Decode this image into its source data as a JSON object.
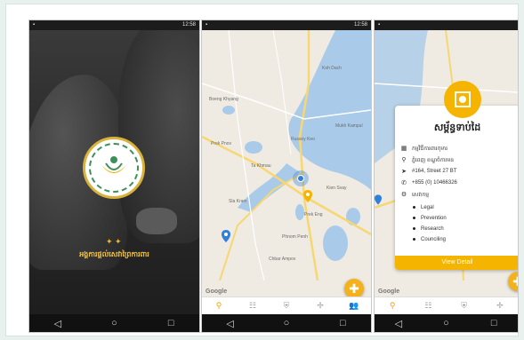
{
  "statusbar": {
    "time1": "12:58",
    "time2": "12:58",
    "time3": "",
    "icons": "▾ ▮"
  },
  "splash": {
    "brand_mark": "✦ ✦",
    "title": "អង្គការផ្តល់សេវាព្រៃការពារ"
  },
  "map": {
    "labels": [
      "Prek Pnov",
      "Ta Khmau",
      "Koh Dach",
      "Russey Keo",
      "Kien Svay",
      "Prek Eng",
      "Sla Kram",
      "Phnom Penh",
      "Boeng Khyang",
      "Mukh Kampul",
      "Chbar Ampov"
    ],
    "google": "Google"
  },
  "tabs": [
    {
      "icon": "location-pin-icon",
      "glyph": "⚲"
    },
    {
      "icon": "list-icon",
      "glyph": "☷"
    },
    {
      "icon": "shield-icon",
      "glyph": "⛨"
    },
    {
      "icon": "service-icon",
      "glyph": "✢"
    },
    {
      "icon": "people-icon",
      "glyph": "👥"
    }
  ],
  "nav": {
    "back": "◁",
    "home": "○",
    "recent": "□"
  },
  "detail": {
    "title": "សម្ព័ន្ធទាប់ដៃ",
    "org": "កម្មវិធីការពារកុមារ",
    "location": "ភ្នំពេញ ខណ្ឌចំការមន",
    "address": "#164, Street 27 BT",
    "phone": "+855 (0) 10466326",
    "services_label": "សេវាកម្ម",
    "services": [
      "Legal",
      "Prevention",
      "Research",
      "Counciling"
    ],
    "button": "View Detail"
  },
  "colors": {
    "accent": "#f4b400",
    "pin_blue": "#2f7fdb",
    "water": "#a9cbe9",
    "road": "#f7d772"
  }
}
